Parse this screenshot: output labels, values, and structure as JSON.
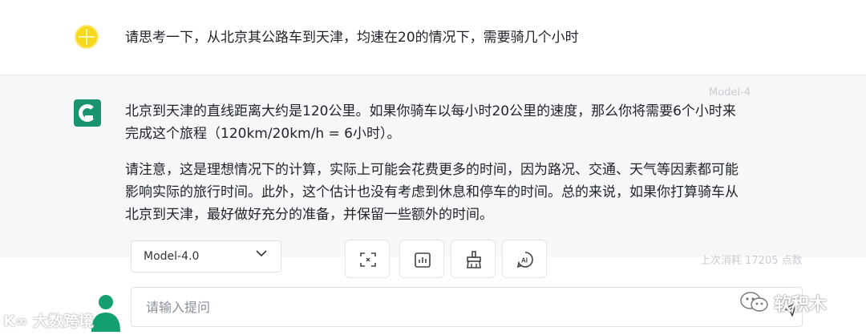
{
  "user": {
    "message": "请思考一下，从北京其公路车到天津，均速在20的情况下，需要骑几个小时"
  },
  "bot": {
    "model_tag": "Model-4",
    "paragraph_1": "北京到天津的直线距离大约是120公里。如果你骑车以每小时20公里的速度，那么你将需要6个小时来完成这个旅程（120km/20km/h = 6小时）。",
    "paragraph_2": "请注意，这是理想情况下的计算，实际上可能会花费更多的时间，因为路况、交通、天气等因素都可能影响实际的旅行时间。此外，这个估计也没有考虑到休息和停车的时间。总的来说，如果你打算骑车从北京到天津，最好做好充分的准备，并保留一些额外的时间。"
  },
  "toolbar": {
    "model_select_value": "Model-4.0",
    "usage_text": "上次消耗 17205 点数",
    "tools": [
      {
        "icon": "expand-icon"
      },
      {
        "icon": "chart-icon"
      },
      {
        "icon": "clear-icon"
      },
      {
        "icon": "ai-icon"
      }
    ]
  },
  "input": {
    "placeholder": "请输入提问"
  },
  "watermarks": {
    "left": "大数跨境",
    "right": "软积木"
  },
  "colors": {
    "user_avatar": "#f7d81b",
    "bot_avatar": "#1a9470",
    "bot_bg": "#f6f7f8",
    "bottom_avatar": "#14a06e"
  }
}
